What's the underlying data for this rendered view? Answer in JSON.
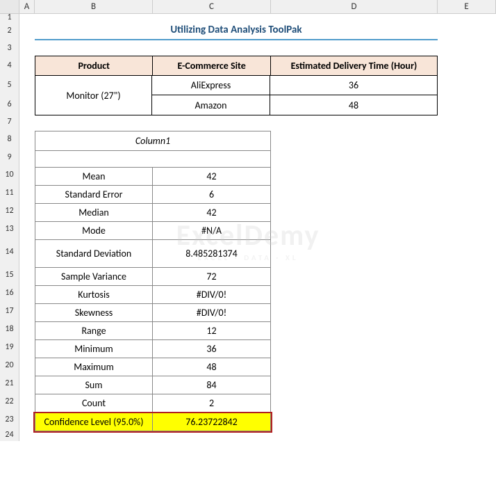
{
  "columns": [
    "A",
    "B",
    "C",
    "D",
    "E"
  ],
  "rows": [
    "1",
    "2",
    "3",
    "4",
    "5",
    "6",
    "7",
    "8",
    "9",
    "10",
    "11",
    "12",
    "13",
    "14",
    "15",
    "16",
    "17",
    "18",
    "19",
    "20",
    "21",
    "22",
    "23",
    "24"
  ],
  "title": "Utilizing Data Analysis ToolPak",
  "table1": {
    "headers": {
      "product": "Product",
      "site": "E-Commerce Site",
      "time": "Estimated Delivery Time (Hour)"
    },
    "product": "Monitor (27\")",
    "rows": [
      {
        "site": "AliExpress",
        "time": "36"
      },
      {
        "site": "Amazon",
        "time": "48"
      }
    ]
  },
  "stats": {
    "title": "Column1",
    "rows": [
      {
        "label": "Mean",
        "value": "42"
      },
      {
        "label": "Standard Error",
        "value": "6"
      },
      {
        "label": "Median",
        "value": "42"
      },
      {
        "label": "Mode",
        "value": "#N/A"
      },
      {
        "label": "Standard Deviation",
        "value": "8.485281374"
      },
      {
        "label": "Sample Variance",
        "value": "72"
      },
      {
        "label": "Kurtosis",
        "value": "#DIV/0!"
      },
      {
        "label": "Skewness",
        "value": "#DIV/0!"
      },
      {
        "label": "Range",
        "value": "12"
      },
      {
        "label": "Minimum",
        "value": "36"
      },
      {
        "label": "Maximum",
        "value": "48"
      },
      {
        "label": "Sum",
        "value": "84"
      },
      {
        "label": "Count",
        "value": "2"
      },
      {
        "label": "Confidence Level (95.0%)",
        "value": "76.23722842"
      }
    ]
  },
  "watermark": {
    "main": "ExcelDemy",
    "sub": "EXCEL · DATA · XL"
  }
}
